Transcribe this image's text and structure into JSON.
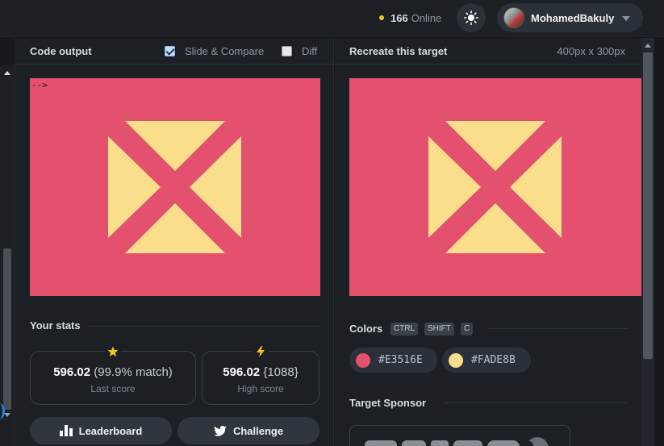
{
  "header": {
    "online_count": "166",
    "online_label": "Online",
    "username": "MohamedBakuly"
  },
  "left_panel": {
    "title": "Code output",
    "slide_compare_label": "Slide & Compare",
    "slide_compare_checked": true,
    "diff_label": "Diff",
    "diff_checked": false,
    "output_stray_text": "-->"
  },
  "right_panel": {
    "title": "Recreate this target",
    "dimensions": "400px x 300px"
  },
  "stats": {
    "title": "Your stats",
    "last_score_value": "596.02",
    "last_score_detail": "(99.9% match)",
    "last_score_label": "Last score",
    "high_score_value": "596.02",
    "high_score_detail": "{1088}",
    "high_score_label": "High score"
  },
  "buttons": {
    "leaderboard": "Leaderboard",
    "challenge": "Challenge"
  },
  "colors": {
    "title": "Colors",
    "shortcut_keys": [
      "CTRL",
      "SHIFT",
      "C"
    ],
    "swatches": [
      {
        "hex": "#E3516E"
      },
      {
        "hex": "#FADE8B"
      }
    ]
  },
  "sponsor": {
    "title": "Target Sponsor"
  },
  "icons": {
    "theme": "sun-icon",
    "star": "star-icon",
    "bolt": "lightning-icon",
    "leaderboard": "bar-chart-icon",
    "challenge": "twitter-bird-icon"
  }
}
